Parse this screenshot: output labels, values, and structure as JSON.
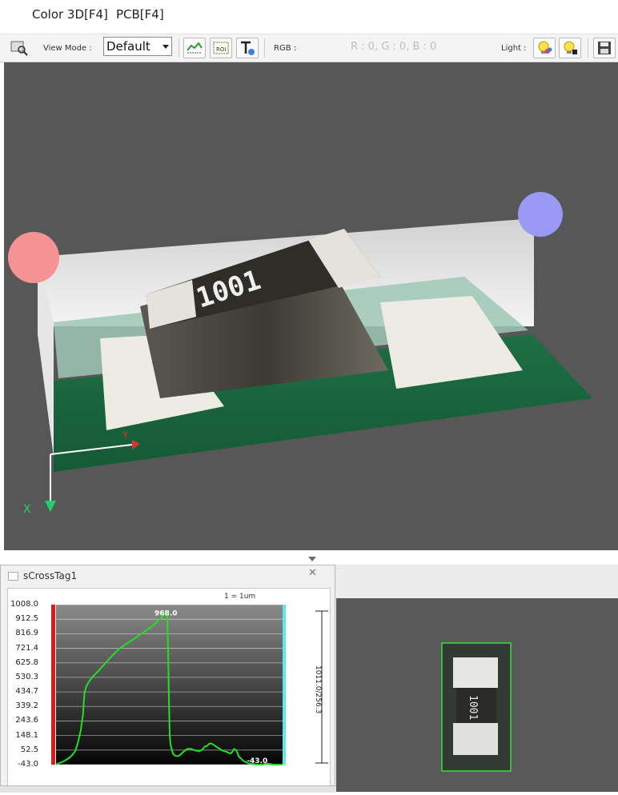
{
  "tabs": [
    {
      "label": "Color 3D[F4]"
    },
    {
      "label": "PCB[F4]"
    }
  ],
  "toolbar": {
    "view_mode_label": "View Mode :",
    "view_mode_value": "Default",
    "rgb_label": "RGB :",
    "rgb_value": "R : 0, G : 0, B : 0",
    "light_label": "Light :",
    "roi_text": "ROI"
  },
  "viewport_3d": {
    "component_marking": "1001",
    "axis_y_label": "Y",
    "axis_x_label": "X",
    "light_left_color": "#f59393",
    "light_right_color": "#9a9af5"
  },
  "cross_section": {
    "title": "sCrossTag1",
    "scale_text": "1 = 1um",
    "peak_label": "968.0",
    "min_label": "-43.0",
    "side_label": "1011.0/256.3",
    "y_ticks": [
      "1008.0",
      "912.5",
      "816.9",
      "721.4",
      "625.8",
      "530.3",
      "434.7",
      "339.2",
      "243.6",
      "148.1",
      "52.5",
      "-43.0"
    ],
    "line_color": "#22e022"
  },
  "chart_data": {
    "type": "line",
    "title": "sCrossTag1",
    "xlabel": "",
    "ylabel": "",
    "ylim": [
      -43.0,
      1008.0
    ],
    "y_ticks": [
      1008.0,
      912.5,
      816.9,
      721.4,
      625.8,
      530.3,
      434.7,
      339.2,
      243.6,
      148.1,
      52.5,
      -43.0
    ],
    "annotations": [
      "968.0",
      "-43.0",
      "1 = 1um",
      "1011.0/256.3"
    ],
    "series": [
      {
        "color": "#22e022",
        "x": [
          0,
          3,
          6,
          10,
          15,
          20,
          24,
          27,
          31,
          34,
          35,
          36,
          38,
          40,
          42,
          44,
          47,
          52,
          58,
          65,
          72,
          80,
          90,
          100,
          110,
          118,
          124,
          129,
          133,
          137,
          138,
          139,
          140,
          141,
          142,
          143,
          144,
          147,
          150,
          153,
          156,
          160,
          165,
          170,
          175,
          180,
          184,
          187,
          190,
          193,
          196,
          200,
          203,
          206,
          209,
          212,
          215,
          217,
          219,
          221,
          224,
          227,
          230,
          233,
          236,
          240,
          244,
          248,
          252,
          256,
          260,
          262,
          264,
          266,
          268,
          270,
          273,
          276,
          279,
          282,
          285
        ],
        "values": [
          -43,
          -35,
          -30,
          -20,
          -5,
          18,
          45,
          90,
          180,
          290,
          380,
          430,
          470,
          490,
          505,
          520,
          540,
          565,
          600,
          640,
          680,
          720,
          755,
          790,
          825,
          855,
          880,
          905,
          925,
          945,
          968,
          968,
          940,
          700,
          400,
          150,
          90,
          30,
          15,
          12,
          20,
          40,
          60,
          60,
          50,
          45,
          55,
          75,
          80,
          95,
          95,
          80,
          70,
          60,
          50,
          45,
          40,
          35,
          30,
          35,
          60,
          50,
          10,
          -5,
          -20,
          -30,
          -38,
          -40,
          -43,
          -43,
          -43,
          -40,
          -38,
          -36,
          -38,
          -40,
          -43,
          -43,
          -43,
          -43,
          -43
        ]
      }
    ]
  }
}
